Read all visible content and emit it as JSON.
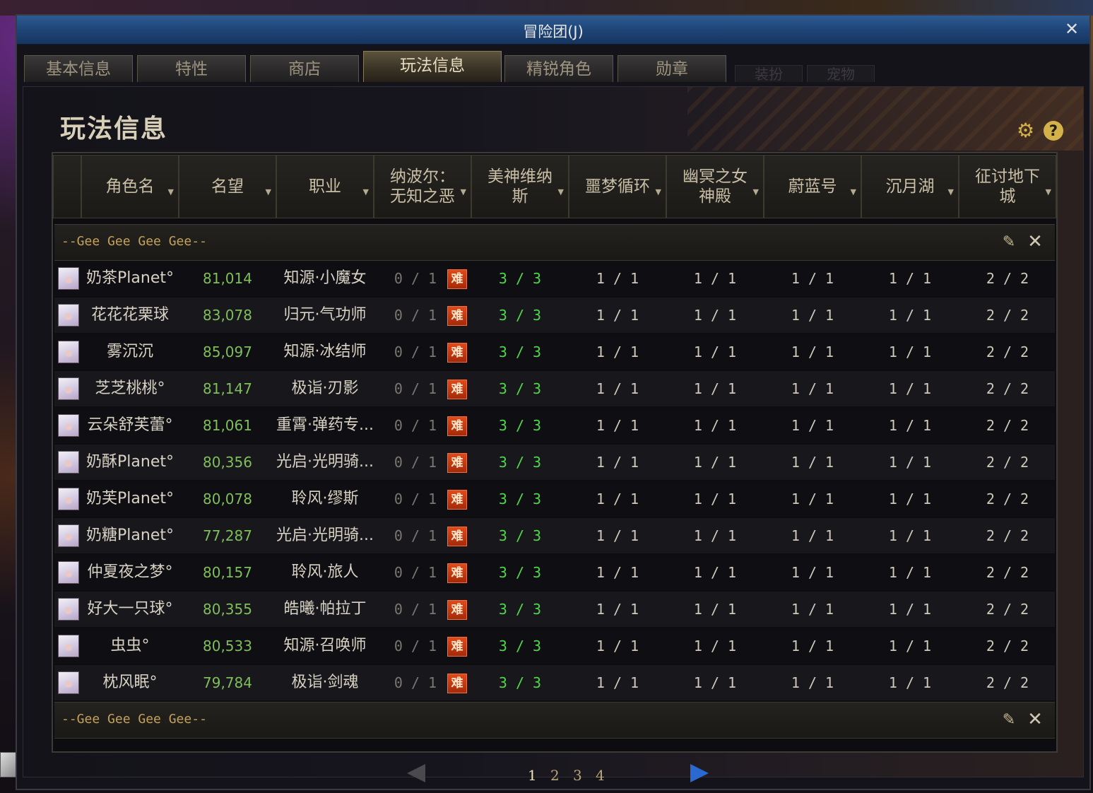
{
  "window": {
    "title": "冒险团(J)"
  },
  "tabs": [
    {
      "label": "基本信息"
    },
    {
      "label": "特性"
    },
    {
      "label": "商店"
    },
    {
      "label": "玩法信息"
    },
    {
      "label": "精锐角色"
    },
    {
      "label": "勋章"
    },
    {
      "label": "装扮"
    },
    {
      "label": "宠物"
    }
  ],
  "panel": {
    "title": "玩法信息"
  },
  "columns": [
    {
      "label": "角色名"
    },
    {
      "label": "名望"
    },
    {
      "label": "职业"
    },
    {
      "label": "纳波尔：无知之恶"
    },
    {
      "label": "美神维纳斯"
    },
    {
      "label": "噩梦循环"
    },
    {
      "label": "幽冥之女神殿"
    },
    {
      "label": "蔚蓝号"
    },
    {
      "label": "沉月湖"
    },
    {
      "label": "征讨地下城"
    }
  ],
  "group": {
    "name": "--Gee Gee Gee Gee--"
  },
  "hard_label": "难",
  "rows": [
    {
      "name": "奶茶Planet°",
      "fame": "81,014",
      "job": "知源·小魔女",
      "nab": "0 / 1",
      "venus": "3 / 3",
      "nightmare": "1 / 1",
      "temple": "1 / 1",
      "azure": "1 / 1",
      "moonlake": "1 / 1",
      "dungeon": "2 / 2"
    },
    {
      "name": "花花花栗球",
      "fame": "83,078",
      "job": "归元·气功师",
      "nab": "0 / 1",
      "venus": "3 / 3",
      "nightmare": "1 / 1",
      "temple": "1 / 1",
      "azure": "1 / 1",
      "moonlake": "1 / 1",
      "dungeon": "2 / 2"
    },
    {
      "name": "雾沉沉",
      "fame": "85,097",
      "job": "知源·冰结师",
      "nab": "0 / 1",
      "venus": "3 / 3",
      "nightmare": "1 / 1",
      "temple": "1 / 1",
      "azure": "1 / 1",
      "moonlake": "1 / 1",
      "dungeon": "2 / 2"
    },
    {
      "name": "芝芝桃桃°",
      "fame": "81,147",
      "job": "极诣·刃影",
      "nab": "0 / 1",
      "venus": "3 / 3",
      "nightmare": "1 / 1",
      "temple": "1 / 1",
      "azure": "1 / 1",
      "moonlake": "1 / 1",
      "dungeon": "2 / 2"
    },
    {
      "name": "云朵舒芙蕾°",
      "fame": "81,061",
      "job": "重霄·弹药专...",
      "nab": "0 / 1",
      "venus": "3 / 3",
      "nightmare": "1 / 1",
      "temple": "1 / 1",
      "azure": "1 / 1",
      "moonlake": "1 / 1",
      "dungeon": "2 / 2"
    },
    {
      "name": "奶酥Planet°",
      "fame": "80,356",
      "job": "光启·光明骑...",
      "nab": "0 / 1",
      "venus": "3 / 3",
      "nightmare": "1 / 1",
      "temple": "1 / 1",
      "azure": "1 / 1",
      "moonlake": "1 / 1",
      "dungeon": "2 / 2"
    },
    {
      "name": "奶芙Planet°",
      "fame": "80,078",
      "job": "聆风·缪斯",
      "nab": "0 / 1",
      "venus": "3 / 3",
      "nightmare": "1 / 1",
      "temple": "1 / 1",
      "azure": "1 / 1",
      "moonlake": "1 / 1",
      "dungeon": "2 / 2"
    },
    {
      "name": "奶糖Planet°",
      "fame": "77,287",
      "job": "光启·光明骑...",
      "nab": "0 / 1",
      "venus": "3 / 3",
      "nightmare": "1 / 1",
      "temple": "1 / 1",
      "azure": "1 / 1",
      "moonlake": "1 / 1",
      "dungeon": "2 / 2"
    },
    {
      "name": "仲夏夜之梦°",
      "fame": "80,157",
      "job": "聆风·旅人",
      "nab": "0 / 1",
      "venus": "3 / 3",
      "nightmare": "1 / 1",
      "temple": "1 / 1",
      "azure": "1 / 1",
      "moonlake": "1 / 1",
      "dungeon": "2 / 2"
    },
    {
      "name": "好大一只球°",
      "fame": "80,355",
      "job": "皓曦·帕拉丁",
      "nab": "0 / 1",
      "venus": "3 / 3",
      "nightmare": "1 / 1",
      "temple": "1 / 1",
      "azure": "1 / 1",
      "moonlake": "1 / 1",
      "dungeon": "2 / 2"
    },
    {
      "name": "虫虫°",
      "fame": "80,533",
      "job": "知源·召唤师",
      "nab": "0 / 1",
      "venus": "3 / 3",
      "nightmare": "1 / 1",
      "temple": "1 / 1",
      "azure": "1 / 1",
      "moonlake": "1 / 1",
      "dungeon": "2 / 2"
    },
    {
      "name": "枕风眠°",
      "fame": "79,784",
      "job": "极诣·剑魂",
      "nab": "0 / 1",
      "venus": "3 / 3",
      "nightmare": "1 / 1",
      "temple": "1 / 1",
      "azure": "1 / 1",
      "moonlake": "1 / 1",
      "dungeon": "2 / 2"
    }
  ],
  "pager": {
    "pages": [
      "1",
      "2",
      "3",
      "4"
    ],
    "current": "1"
  },
  "colors": {
    "fame": "#7fbf5a",
    "clear": "#4fd84a",
    "hard": "#e04a1a",
    "title_bar": "#1f4577",
    "next_arrow": "#2a6ad0"
  },
  "icons": {
    "close": "close-icon",
    "settings": "gear-icon",
    "help": "help-icon",
    "edit": "edit-icon",
    "delete": "delete-icon",
    "prev": "prev-arrow-icon",
    "next": "next-arrow-icon"
  }
}
